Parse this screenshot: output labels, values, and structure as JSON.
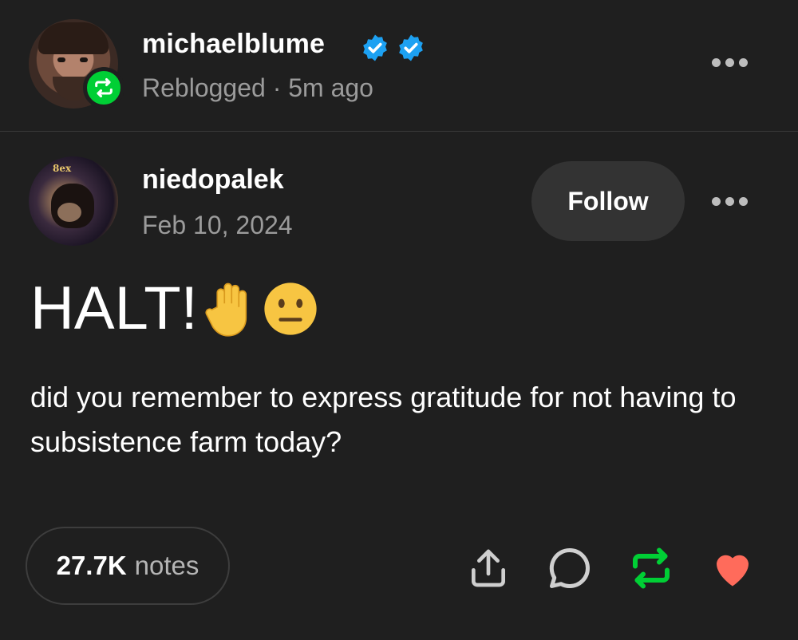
{
  "reblogger": {
    "name": "michaelblume",
    "meta": "Reblogged · 5m ago",
    "badge_icon": "reblog-icon",
    "verified_icon": "verified-badge-icon"
  },
  "post": {
    "author": "niedopalek",
    "date": "Feb 10, 2024",
    "follow_label": "Follow",
    "headline": "HALT!",
    "headline_emojis": [
      "raised-hand-emoji",
      "neutral-face-emoji"
    ],
    "body": "did you remember to express gratitude for not having to subsistence farm today?"
  },
  "footer": {
    "notes_count": "27.7K",
    "notes_label": "notes",
    "actions": [
      "share-icon",
      "comment-icon",
      "reblog-icon",
      "like-heart-icon"
    ]
  },
  "colors": {
    "background": "#1f1f1f",
    "reblog_green": "#00cf35",
    "verified_blue": "#1da1f2",
    "heart_red": "#ff6b5b",
    "muted_text": "#9b9b9b"
  }
}
